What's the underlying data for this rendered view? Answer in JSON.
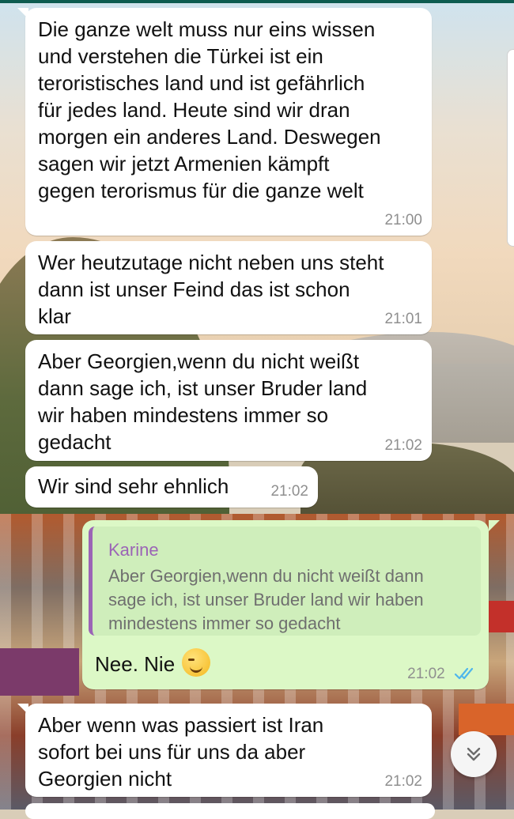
{
  "chat": {
    "messages": [
      {
        "direction": "in",
        "text": "Die ganze welt muss nur eins wissen\nund verstehen die Türkei ist ein\nteroristisches land und ist gefährlich\nfür jedes land. Heute sind wir dran\nmorgen ein anderes Land. Deswegen\nsagen wir jetzt Armenien kämpft\ngegen terorismus für die ganze welt",
        "time": "21:00"
      },
      {
        "direction": "in",
        "text": "Wer heutzutage nicht neben uns steht\ndann ist unser Feind das ist schon\nklar",
        "time": "21:01"
      },
      {
        "direction": "in",
        "text": "Aber Georgien,wenn du nicht weißt\ndann sage ich, ist unser Bruder land\nwir haben mindestens immer so\ngedacht",
        "time": "21:02"
      },
      {
        "direction": "in",
        "text": "Wir sind sehr ehnlich",
        "time": "21:02"
      },
      {
        "direction": "out",
        "quote": {
          "author": "Karine",
          "text": "Aber Georgien,wenn du nicht weißt dann\nsage ich, ist unser Bruder land wir haben\nmindestens immer so gedacht"
        },
        "text": "Nee. Nie",
        "emoji": "winking-smile-emoji",
        "time": "21:02",
        "status": "read"
      },
      {
        "direction": "in",
        "text": "Aber wenn was passiert ist Iran\nsofort bei uns für uns da aber\nGeorgien nicht",
        "time": "21:02"
      }
    ]
  },
  "colors": {
    "incoming_bubble": "#ffffff",
    "outgoing_bubble": "#dcf8c6",
    "quote_accent": "#9b64b6",
    "read_ticks": "#4fb6ec",
    "timestamp": "#8f8f8f"
  },
  "icons": {
    "scroll_down": "double-chevron-down-icon",
    "read_receipt": "double-check-icon"
  }
}
